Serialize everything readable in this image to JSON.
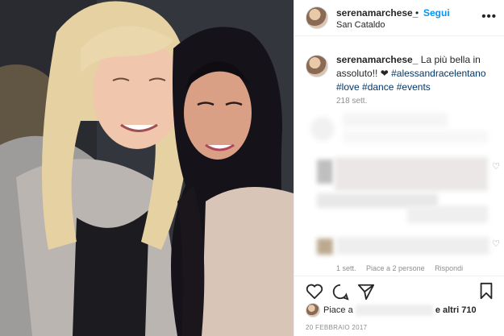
{
  "post": {
    "username": "serenamarchese_",
    "follow_label": "Segui",
    "location": "San Cataldo",
    "more_label": "•••",
    "caption": {
      "username": "serenamarchese_",
      "text": "La più bella in assoluto!! ❤",
      "hashtags": [
        "#alessandracelentano",
        "#love",
        "#dance",
        "#events"
      ]
    },
    "caption_age": "218 sett.",
    "comment_meta": {
      "age": "1 sett.",
      "likes": "Piace a 2 persone",
      "reply": "Rispondi"
    },
    "likes_prefix": "Piace a",
    "likes_suffix": "e altri 710",
    "date": "20 FEBBRAIO 2017"
  },
  "icons": {
    "heart": "heart-icon",
    "comment": "comment-icon",
    "share": "share-icon",
    "save": "bookmark-icon"
  },
  "colors": {
    "link": "#0095f6",
    "hashtag": "#00376b",
    "muted": "#8e8e8e"
  }
}
